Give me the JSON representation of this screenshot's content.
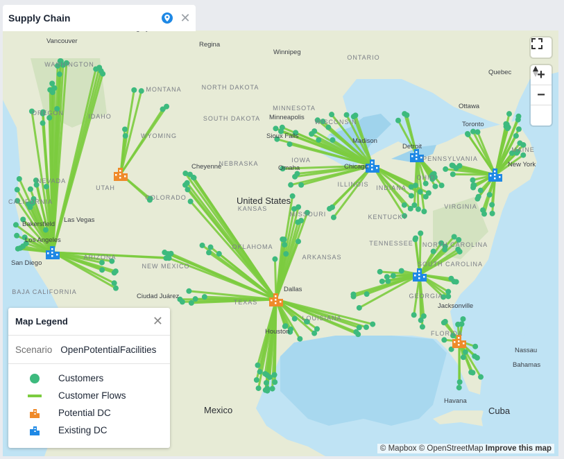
{
  "tab": {
    "title": "Supply Chain",
    "pin_icon": "location-pin-icon",
    "close_icon": "close-icon"
  },
  "map": {
    "country_labels": [
      "United States",
      "Mexico",
      "Cuba"
    ],
    "state_labels": [
      "WASHINGTON",
      "OREGON",
      "IDAHO",
      "MONTANA",
      "WYOMING",
      "NORTH DAKOTA",
      "SOUTH DAKOTA",
      "NEBRASKA",
      "MINNESOTA",
      "WISCONSIN",
      "IOWA",
      "ILLINOIS",
      "INDIANA",
      "OHIO",
      "PENNSYLVANIA",
      "KANSAS",
      "MISSOURI",
      "KENTUCKY",
      "COLORADO",
      "UTAH",
      "NEVADA",
      "CALIFORNIA",
      "ARIZONA",
      "NEW MEXICO",
      "OKLAHOMA",
      "ARKANSAS",
      "TEXAS",
      "LOUISIANA",
      "TENNESSEE",
      "GEORGIA",
      "SOUTH CAROLINA",
      "NORTH CAROLINA",
      "VIRGINIA",
      "ONTARIO",
      "MAINE",
      "FLORIDA",
      "BAJA CALIFORNIA"
    ],
    "city_labels": [
      "Vancouver",
      "Calgary",
      "Regina",
      "Winnipeg",
      "Quebec",
      "Ottawa",
      "Toronto",
      "Detroit",
      "Chicago",
      "Madison",
      "Minneapolis",
      "Sioux Falls",
      "Omaha",
      "Cheyenne",
      "Las Vegas",
      "Bakersfield",
      "Los Angeles",
      "San Diego",
      "Ciudad Juárez",
      "Dallas",
      "Houston",
      "Jacksonville",
      "New York",
      "Nassau",
      "Bahamas",
      "Havana",
      "Cuba",
      "Mexico"
    ],
    "colors": {
      "water": "#bfe3f4",
      "land": "#e8ecd8",
      "flow": "#7ccc3f",
      "customer": "#3dba7e",
      "existing_dc": "#1e88e5",
      "potential_dc": "#ef8a2a"
    }
  },
  "controls": {
    "fullscreen_icon": "fullscreen-icon",
    "zoom_in": "+",
    "zoom_out": "−",
    "compass_icon": "compass-icon"
  },
  "legend": {
    "title": "Map Legend",
    "close_icon": "close-icon",
    "scenario_key": "Scenario",
    "scenario_value": "OpenPotentialFacilities",
    "items": [
      {
        "label": "Customers",
        "icon": "customer-dot-icon"
      },
      {
        "label": "Customer Flows",
        "icon": "flow-line-icon"
      },
      {
        "label": "Potential DC",
        "icon": "potential-dc-icon"
      },
      {
        "label": "Existing DC",
        "icon": "existing-dc-icon"
      }
    ]
  },
  "attribution": {
    "mapbox": "© Mapbox",
    "osm": "© OpenStreetMap",
    "improve": "Improve this map"
  }
}
